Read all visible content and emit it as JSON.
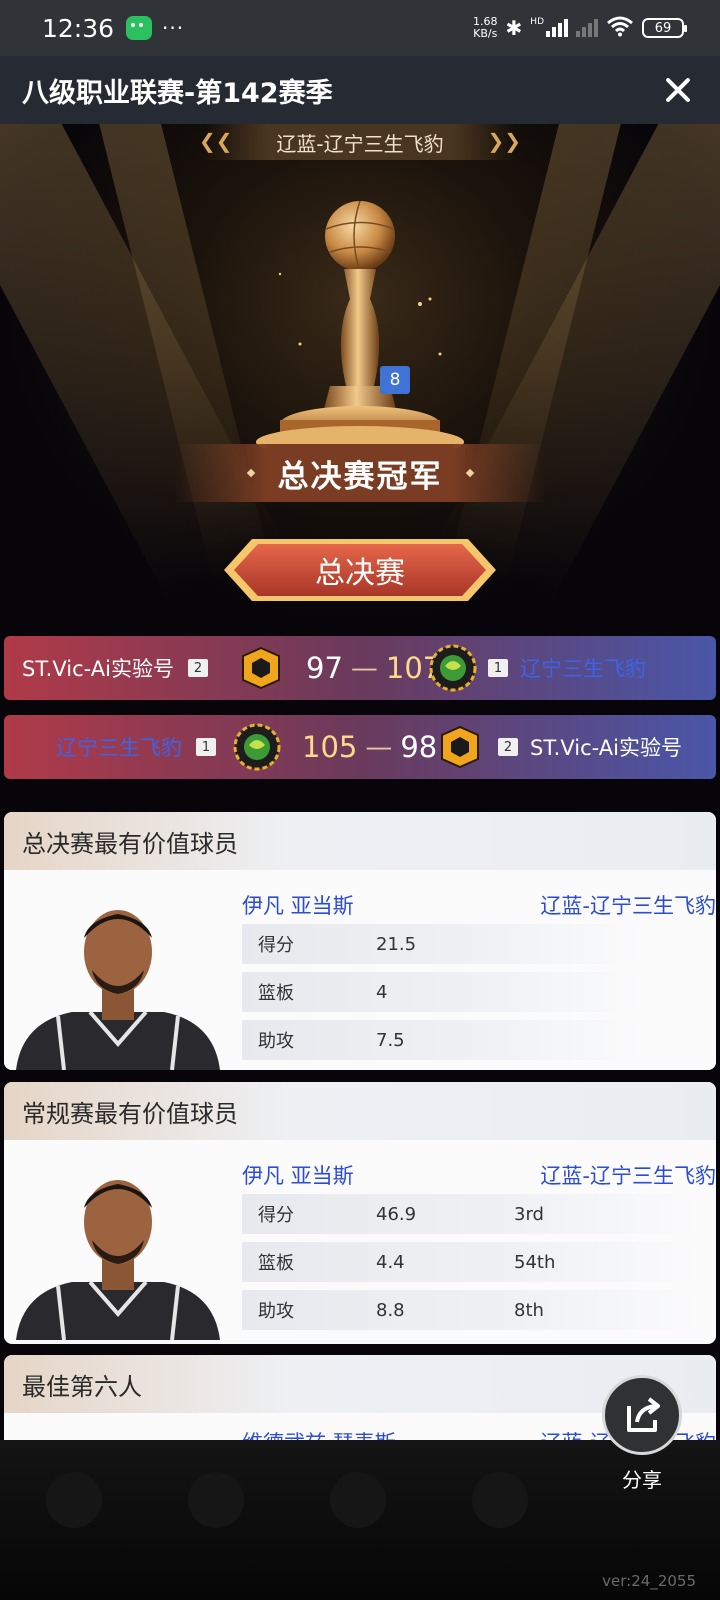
{
  "status_bar": {
    "time": "12:36",
    "net_speed_value": "1.68",
    "net_speed_unit": "KB/s",
    "battery": "69",
    "network_label": "HD"
  },
  "header": {
    "title": "八级职业联赛-第142赛季"
  },
  "hero": {
    "team_banner": "辽蓝-辽宁三生飞豹",
    "rank_badge": "8",
    "champion_title": "总决赛冠军",
    "final_button": "总决赛"
  },
  "games": [
    {
      "left_team": "ST.Vic-Ai实验号",
      "left_seed": "2",
      "left_score": "97",
      "right_score": "107",
      "right_seed": "1",
      "right_team": "辽宁三生飞豹"
    },
    {
      "left_team": "辽宁三生飞豹",
      "left_seed": "1",
      "left_score": "105",
      "right_score": "98",
      "right_seed": "2",
      "right_team": "ST.Vic-Ai实验号"
    }
  ],
  "awards": [
    {
      "title": "总决赛最有价值球员",
      "player": "伊凡 亚当斯",
      "team": "辽蓝-辽宁三生飞豹",
      "stats": [
        {
          "label": "得分",
          "value": "21.5",
          "rank": ""
        },
        {
          "label": "篮板",
          "value": "4",
          "rank": ""
        },
        {
          "label": "助攻",
          "value": "7.5",
          "rank": ""
        }
      ]
    },
    {
      "title": "常规赛最有价值球员",
      "player": "伊凡 亚当斯",
      "team": "辽蓝-辽宁三生飞豹",
      "stats": [
        {
          "label": "得分",
          "value": "46.9",
          "rank": "3rd"
        },
        {
          "label": "篮板",
          "value": "4.4",
          "rank": "54th"
        },
        {
          "label": "助攻",
          "value": "8.8",
          "rank": "8th"
        }
      ]
    },
    {
      "title": "最佳第六人",
      "player": "维德武兹 瑟麦斯",
      "team": "辽蓝-辽宁三生飞豹"
    }
  ],
  "share": {
    "label": "分享"
  },
  "footer": {
    "version": "ver:24_2055"
  },
  "colors": {
    "team_blue": "#2c4cd6",
    "gold": "#ffd98a",
    "banner_brown": "#7a3d24"
  }
}
